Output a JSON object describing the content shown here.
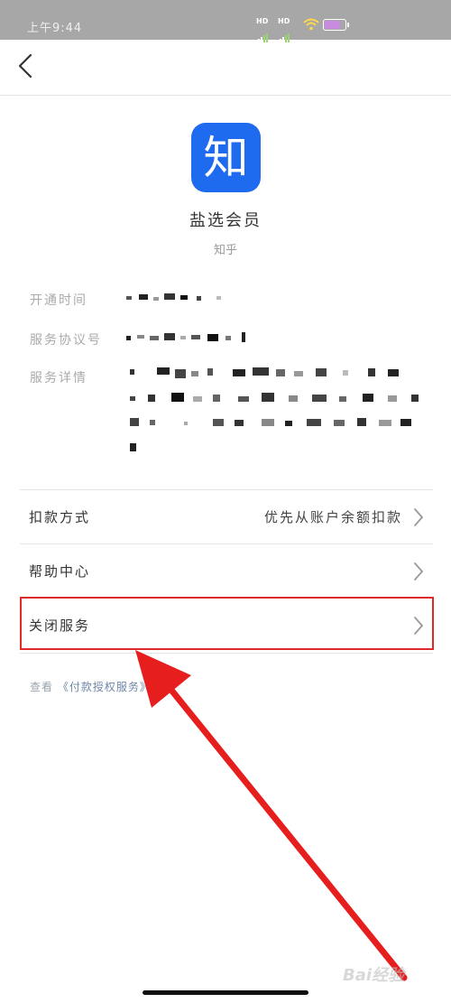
{
  "status_bar": {
    "time": "上午9:44",
    "network_1": "HD",
    "network_2": "HD"
  },
  "nav": {
    "back_icon": "chevron-left-icon"
  },
  "app": {
    "icon_char": "知",
    "name": "盐选会员",
    "provider": "知乎"
  },
  "info": {
    "open_time_label": "开通时间",
    "agreement_no_label": "服务协议号",
    "details_label": "服务详情"
  },
  "menu": [
    {
      "label": "扣款方式",
      "value": "优先从账户余额扣款"
    },
    {
      "label": "帮助中心",
      "value": ""
    },
    {
      "label": "关闭服务",
      "value": ""
    }
  ],
  "footer": {
    "prefix": "查看",
    "link": "《付款授权服务》"
  },
  "watermark": "Bai经验",
  "colors": {
    "accent": "#1f6bf0",
    "highlight": "#e02a2a",
    "arrow": "#e61e1e"
  }
}
